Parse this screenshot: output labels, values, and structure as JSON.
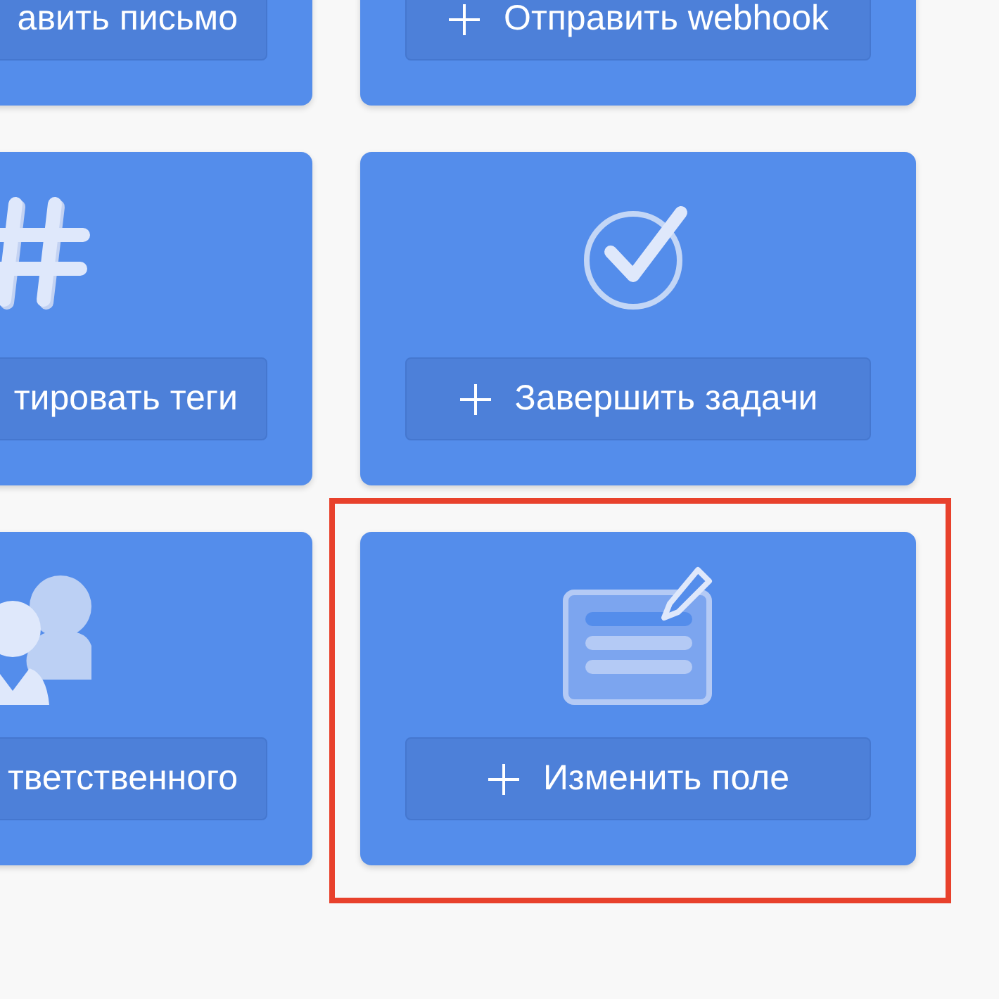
{
  "cards": [
    {
      "button": "авить письмо",
      "highlighted": false
    },
    {
      "button": "Отправить webhook",
      "highlighted": false
    },
    {
      "kind": "hashtag",
      "button": "тировать теги",
      "highlighted": false
    },
    {
      "kind": "check",
      "button": "Завершить задачи",
      "highlighted": false
    },
    {
      "kind": "people",
      "button": "тветственного",
      "highlighted": false
    },
    {
      "kind": "form",
      "button": "Изменить поле",
      "highlighted": true
    }
  ]
}
